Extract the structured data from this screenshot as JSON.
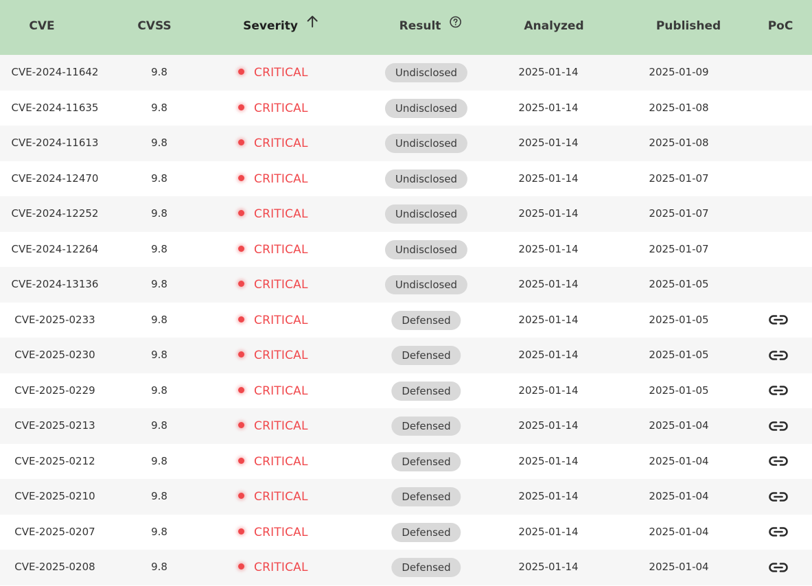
{
  "columns": {
    "cve": "CVE",
    "cvss": "CVSS",
    "severity": "Severity",
    "result": "Result",
    "analyzed": "Analyzed",
    "published": "Published",
    "poc": "PoC"
  },
  "sort": {
    "column": "severity",
    "direction": "ascending",
    "icon": "arrow-up-icon"
  },
  "result_help_icon": "question-circle-icon",
  "colors": {
    "header_bg": "#bedebf",
    "critical": "#f0484c",
    "pill_bg": "#d9d9d9",
    "row_alt": "#f6f6f6"
  },
  "rows": [
    {
      "cve": "CVE-2024-11642",
      "cvss": "9.8",
      "severity": "CRITICAL",
      "result": "Undisclosed",
      "analyzed": "2025-01-14",
      "published": "2025-01-09",
      "poc": false
    },
    {
      "cve": "CVE-2024-11635",
      "cvss": "9.8",
      "severity": "CRITICAL",
      "result": "Undisclosed",
      "analyzed": "2025-01-14",
      "published": "2025-01-08",
      "poc": false
    },
    {
      "cve": "CVE-2024-11613",
      "cvss": "9.8",
      "severity": "CRITICAL",
      "result": "Undisclosed",
      "analyzed": "2025-01-14",
      "published": "2025-01-08",
      "poc": false
    },
    {
      "cve": "CVE-2024-12470",
      "cvss": "9.8",
      "severity": "CRITICAL",
      "result": "Undisclosed",
      "analyzed": "2025-01-14",
      "published": "2025-01-07",
      "poc": false
    },
    {
      "cve": "CVE-2024-12252",
      "cvss": "9.8",
      "severity": "CRITICAL",
      "result": "Undisclosed",
      "analyzed": "2025-01-14",
      "published": "2025-01-07",
      "poc": false
    },
    {
      "cve": "CVE-2024-12264",
      "cvss": "9.8",
      "severity": "CRITICAL",
      "result": "Undisclosed",
      "analyzed": "2025-01-14",
      "published": "2025-01-07",
      "poc": false
    },
    {
      "cve": "CVE-2024-13136",
      "cvss": "9.8",
      "severity": "CRITICAL",
      "result": "Undisclosed",
      "analyzed": "2025-01-14",
      "published": "2025-01-05",
      "poc": false
    },
    {
      "cve": "CVE-2025-0233",
      "cvss": "9.8",
      "severity": "CRITICAL",
      "result": "Defensed",
      "analyzed": "2025-01-14",
      "published": "2025-01-05",
      "poc": true
    },
    {
      "cve": "CVE-2025-0230",
      "cvss": "9.8",
      "severity": "CRITICAL",
      "result": "Defensed",
      "analyzed": "2025-01-14",
      "published": "2025-01-05",
      "poc": true
    },
    {
      "cve": "CVE-2025-0229",
      "cvss": "9.8",
      "severity": "CRITICAL",
      "result": "Defensed",
      "analyzed": "2025-01-14",
      "published": "2025-01-05",
      "poc": true
    },
    {
      "cve": "CVE-2025-0213",
      "cvss": "9.8",
      "severity": "CRITICAL",
      "result": "Defensed",
      "analyzed": "2025-01-14",
      "published": "2025-01-04",
      "poc": true
    },
    {
      "cve": "CVE-2025-0212",
      "cvss": "9.8",
      "severity": "CRITICAL",
      "result": "Defensed",
      "analyzed": "2025-01-14",
      "published": "2025-01-04",
      "poc": true
    },
    {
      "cve": "CVE-2025-0210",
      "cvss": "9.8",
      "severity": "CRITICAL",
      "result": "Defensed",
      "analyzed": "2025-01-14",
      "published": "2025-01-04",
      "poc": true
    },
    {
      "cve": "CVE-2025-0207",
      "cvss": "9.8",
      "severity": "CRITICAL",
      "result": "Defensed",
      "analyzed": "2025-01-14",
      "published": "2025-01-04",
      "poc": true
    },
    {
      "cve": "CVE-2025-0208",
      "cvss": "9.8",
      "severity": "CRITICAL",
      "result": "Defensed",
      "analyzed": "2025-01-14",
      "published": "2025-01-04",
      "poc": true
    }
  ]
}
